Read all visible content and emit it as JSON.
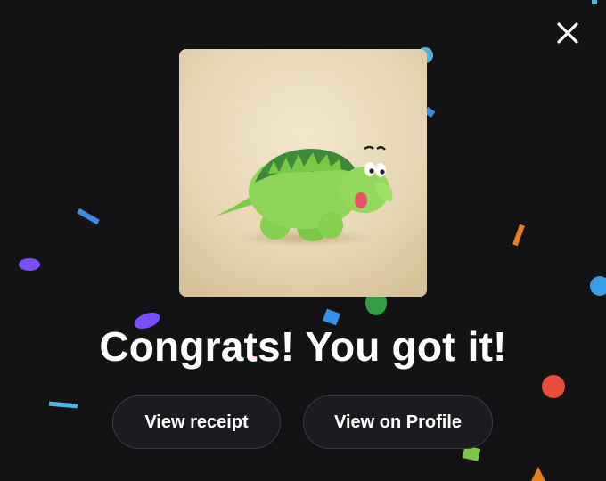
{
  "dialog": {
    "close_icon": "close-icon",
    "artwork": {
      "subject": "green-dinosaur-figure",
      "background_color": "#e6d5b3"
    },
    "headline": "Congrats! You got it!",
    "buttons": {
      "view_receipt": "View receipt",
      "view_on_profile": "View on Profile"
    },
    "colors": {
      "background": "#131315",
      "button_fill": "#1c1c20",
      "button_border": "#3a3a40",
      "text": "#ffffff"
    }
  },
  "confetti_colors": [
    "#4aa3df",
    "#2ecc71",
    "#8e44ad",
    "#e74c3c",
    "#e67e22",
    "#3498db",
    "#7c4dff",
    "#26c6da"
  ]
}
